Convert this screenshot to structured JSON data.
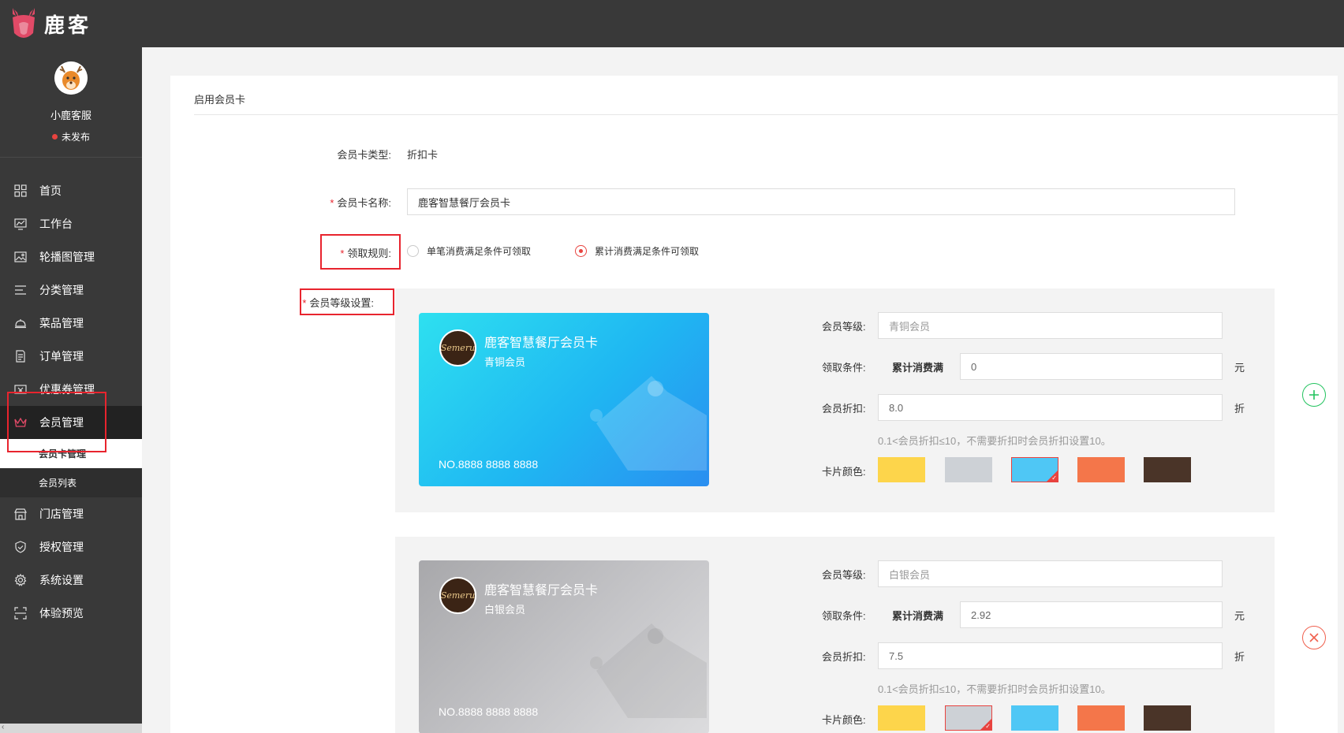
{
  "app": {
    "logo_text": "鹿客"
  },
  "profile": {
    "name": "小鹿客服",
    "status": "未发布"
  },
  "sidebar": {
    "items": [
      {
        "label": "首页",
        "icon": "grid-icon"
      },
      {
        "label": "工作台",
        "icon": "monitor-chart-icon"
      },
      {
        "label": "轮播图管理",
        "icon": "image-icon"
      },
      {
        "label": "分类管理",
        "icon": "list-icon"
      },
      {
        "label": "菜品管理",
        "icon": "cloche-icon"
      },
      {
        "label": "订单管理",
        "icon": "document-icon"
      },
      {
        "label": "优惠券管理",
        "icon": "coupon-icon"
      },
      {
        "label": "会员管理",
        "icon": "crown-icon"
      },
      {
        "label": "门店管理",
        "icon": "store-icon"
      },
      {
        "label": "授权管理",
        "icon": "shield-icon"
      },
      {
        "label": "系统设置",
        "icon": "gear-icon"
      },
      {
        "label": "体验预览",
        "icon": "scan-icon"
      }
    ],
    "sub_items": [
      {
        "label": "会员卡管理"
      },
      {
        "label": "会员列表"
      }
    ]
  },
  "panel": {
    "title": "启用会员卡"
  },
  "form": {
    "type_label": "会员卡类型:",
    "type_value": "折扣卡",
    "name_label": "会员卡名称:",
    "name_value": "鹿客智慧餐厅会员卡",
    "rule_label": "领取规则:",
    "rule_options": [
      {
        "label": "单笔消费满足条件可领取",
        "checked": false
      },
      {
        "label": "累计消费满足条件可领取",
        "checked": true
      }
    ],
    "level_label": "会员等级设置:"
  },
  "levels": [
    {
      "card_title": "鹿客智慧餐厅会员卡",
      "card_level": "青铜会员",
      "card_no": "NO.8888 8888 8888",
      "logo_text": "Semeru",
      "level_label": "会员等级:",
      "level_placeholder": "青铜会员",
      "condition_label": "领取条件:",
      "condition_prefix": "累计消费满",
      "condition_value": "0",
      "condition_unit": "元",
      "discount_label": "会员折扣:",
      "discount_value": "8.0",
      "discount_unit": "折",
      "hint": "0.1<会员折扣≤10，不需要折扣时会员折扣设置10。",
      "color_label": "卡片颜色:",
      "selected_color": 2,
      "action": "add"
    },
    {
      "card_title": "鹿客智慧餐厅会员卡",
      "card_level": "白银会员",
      "card_no": "NO.8888 8888 8888",
      "logo_text": "Semeru",
      "level_label": "会员等级:",
      "level_placeholder": "白银会员",
      "condition_label": "领取条件:",
      "condition_prefix": "累计消费满",
      "condition_value": "2.92",
      "condition_unit": "元",
      "discount_label": "会员折扣:",
      "discount_value": "7.5",
      "discount_unit": "折",
      "hint": "0.1<会员折扣≤10，不需要折扣时会员折扣设置10。",
      "color_label": "卡片颜色:",
      "selected_color": 1,
      "action": "remove"
    }
  ],
  "card_colors": [
    "#fdd54b",
    "#cdd1d6",
    "#4fc7f5",
    "#f4764a",
    "#4a3428"
  ],
  "colors": {
    "topbar": "#393939",
    "sidebar": "#393939",
    "accent_red": "#e8433f",
    "add_green": "#22c35e"
  }
}
